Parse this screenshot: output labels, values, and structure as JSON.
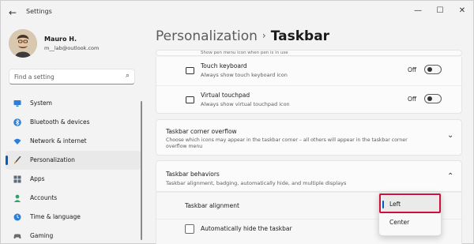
{
  "window": {
    "app_title": "Settings",
    "back_glyph": "←",
    "minimize_glyph": "—",
    "maximize_glyph": "☐",
    "close_glyph": "✕"
  },
  "profile": {
    "name": "Mauro H.",
    "email": "m__lab@outlook.com"
  },
  "search": {
    "placeholder": "Find a setting",
    "icon": "search-icon",
    "icon_glyph": "⌕"
  },
  "sidebar": {
    "items": [
      {
        "label": "System",
        "icon": "monitor-icon",
        "active": false
      },
      {
        "label": "Bluetooth & devices",
        "icon": "bluetooth-icon",
        "active": false
      },
      {
        "label": "Network & internet",
        "icon": "wifi-icon",
        "active": false
      },
      {
        "label": "Personalization",
        "icon": "brush-icon",
        "active": true
      },
      {
        "label": "Apps",
        "icon": "apps-icon",
        "active": false
      },
      {
        "label": "Accounts",
        "icon": "person-icon",
        "active": false
      },
      {
        "label": "Time & language",
        "icon": "globe-clock-icon",
        "active": false
      },
      {
        "label": "Gaming",
        "icon": "gamepad-icon",
        "active": false
      }
    ]
  },
  "header": {
    "parent": "Personalization",
    "separator": "›",
    "current": "Taskbar"
  },
  "taskbar_icons": {
    "clipped_text": "Show pen menu icon when pen is in use",
    "rows": [
      {
        "title": "Touch keyboard",
        "subtitle": "Always show touch keyboard icon",
        "state": "Off",
        "icon": "keyboard-icon"
      },
      {
        "title": "Virtual touchpad",
        "subtitle": "Always show virtual touchpad icon",
        "state": "Off",
        "icon": "touchpad-icon"
      }
    ]
  },
  "corner_overflow": {
    "title": "Taskbar corner overflow",
    "subtitle": "Choose which icons may appear in the taskbar corner – all others will appear in the taskbar corner overflow menu",
    "chevron_glyph": "⌄"
  },
  "behaviors": {
    "title": "Taskbar behaviors",
    "subtitle": "Taskbar alignment, badging, automatically hide, and multiple displays",
    "chevron_glyph": "⌃",
    "alignment_label": "Taskbar alignment",
    "autohide_label": "Automatically hide the taskbar",
    "autohide_checked": false
  },
  "alignment_dropdown": {
    "options": [
      "Left",
      "Center"
    ],
    "selected": "Left"
  },
  "colors": {
    "accent": "#005fb8",
    "highlight_box": "#d0103a",
    "background": "#f3f3f3"
  }
}
